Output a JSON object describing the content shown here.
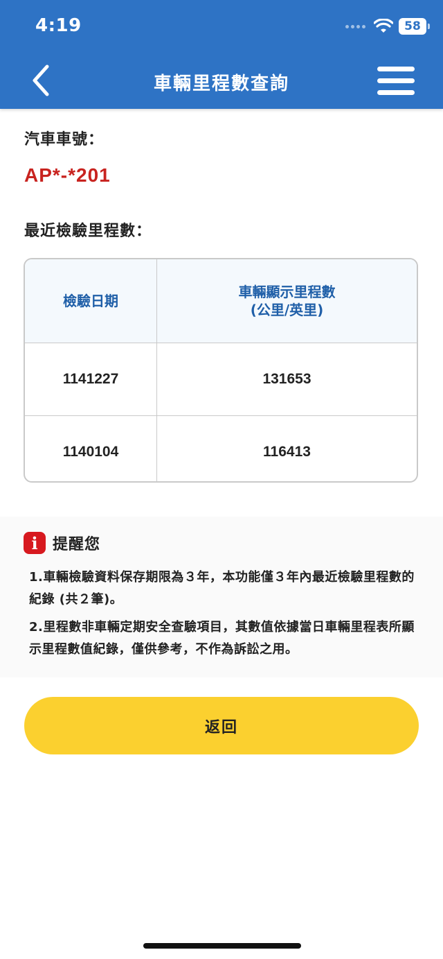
{
  "status_bar": {
    "time": "4:19",
    "battery": "58"
  },
  "header": {
    "title": "車輛里程數查詢",
    "back_icon": "chevron-left-icon",
    "menu_icon": "hamburger-menu-icon",
    "bg_color": "#2e73c5"
  },
  "vehicle": {
    "plate_label": "汽車車號：",
    "plate": "AP*-*201",
    "plate_color": "#c8231f"
  },
  "mileage": {
    "section_label": "最近檢驗里程數：",
    "columns": [
      "檢驗日期",
      "車輛顯示里程數",
      "(公里/英里)"
    ],
    "rows": [
      {
        "date": "1141227",
        "mileage": "131653"
      },
      {
        "date": "1140104",
        "mileage": "116413"
      }
    ]
  },
  "notice": {
    "title": "提醒您",
    "icon": "info-icon",
    "items": [
      "1.車輛檢驗資料保存期限為３年，本功能僅３年內最近檢驗里程數的紀錄 (共２筆)。",
      "2.里程數非車輛定期安全查驗項目，其數值依據當日車輛里程表所顯示里程數值紀錄，僅供參考，不作為訴訟之用。"
    ]
  },
  "actions": {
    "return_label": "返回",
    "button_color": "#fbd02f"
  }
}
